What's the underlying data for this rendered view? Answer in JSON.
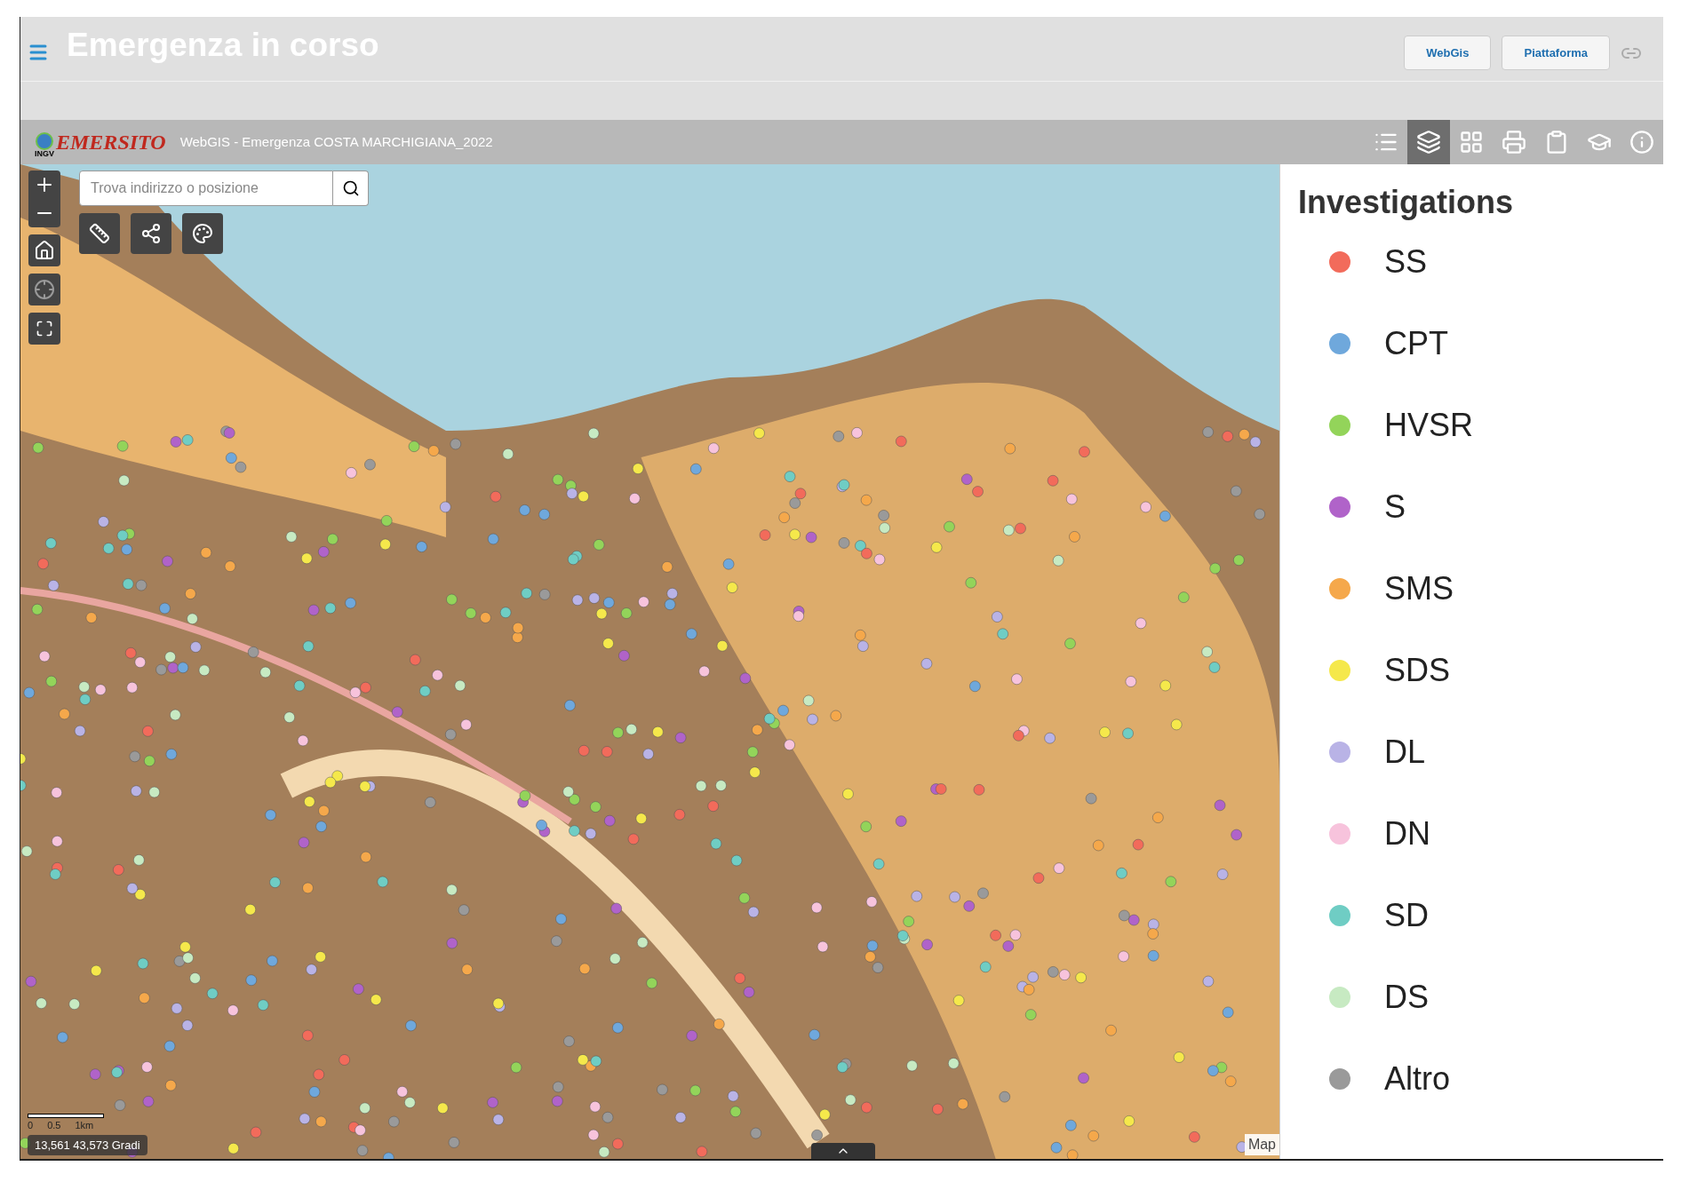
{
  "header": {
    "title": "Emergenza in corso",
    "buttons": [
      "WebGis",
      "Piattaforma"
    ]
  },
  "toolbar": {
    "logo": "EMERSITO",
    "logo_sub": "INGV",
    "title": "WebGIS - Emergenza COSTA MARCHIGIANA_2022",
    "tools": [
      {
        "kind": "list",
        "selected": false
      },
      {
        "kind": "layers",
        "selected": true
      },
      {
        "kind": "grid",
        "selected": false
      },
      {
        "kind": "print",
        "selected": false
      },
      {
        "kind": "bookmark",
        "selected": false
      },
      {
        "kind": "learn",
        "selected": false
      },
      {
        "kind": "info",
        "selected": false
      }
    ]
  },
  "map": {
    "search": {
      "placeholder": "Trova indirizzo o posizione"
    },
    "scale": [
      "0",
      "0.5",
      "1km"
    ],
    "coordinates": "13,561 43,573 Gradi",
    "attribution": "Map"
  },
  "legend": {
    "title": "Investigations",
    "items": [
      {
        "label": "SS",
        "color": "#f26b5b"
      },
      {
        "label": "CPT",
        "color": "#6fa8dc"
      },
      {
        "label": "HVSR",
        "color": "#93d45a"
      },
      {
        "label": "S",
        "color": "#b063c9"
      },
      {
        "label": "SMS",
        "color": "#f5a84b"
      },
      {
        "label": "SDS",
        "color": "#f5e84b"
      },
      {
        "label": "DL",
        "color": "#b9b3e6"
      },
      {
        "label": "DN",
        "color": "#f7c3dc"
      },
      {
        "label": "SD",
        "color": "#6fcdc4"
      },
      {
        "label": "DS",
        "color": "#c7eac2"
      },
      {
        "label": "Altro",
        "color": "#9a9a9a"
      }
    ]
  }
}
